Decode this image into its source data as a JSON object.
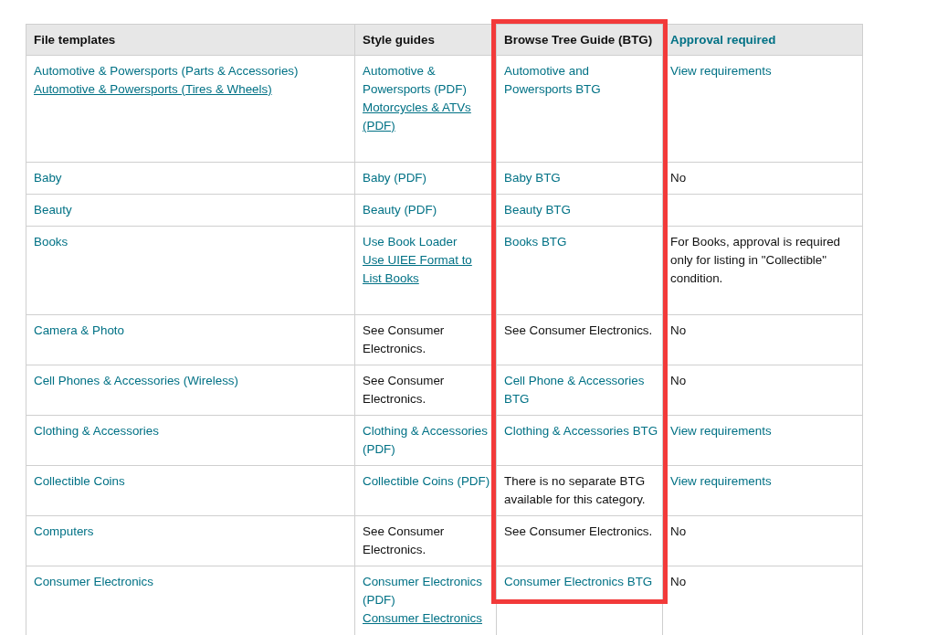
{
  "table": {
    "columns": [
      {
        "label": "File templates",
        "kind": "text"
      },
      {
        "label": "Style guides",
        "kind": "text"
      },
      {
        "label": "Browse Tree Guide (BTG)",
        "kind": "text",
        "highlighted": true
      },
      {
        "label": "Approval required",
        "kind": "link"
      }
    ],
    "rows": [
      {
        "cells": [
          [
            {
              "text": "Automotive & Powersports (Parts & Accessories)",
              "kind": "link",
              "underlined": false
            },
            {
              "text": "Automotive & Powersports (Tires & Wheels)",
              "kind": "link",
              "underlined": true
            }
          ],
          [
            {
              "text": "Automotive & Powersports (PDF)",
              "kind": "link",
              "underlined": false
            },
            {
              "text": "Motorcycles & ATVs (PDF)",
              "kind": "link",
              "underlined": true
            }
          ],
          [
            {
              "text": "Automotive and Powersports BTG",
              "kind": "link",
              "underlined": false
            }
          ],
          [
            {
              "text": "View requirements",
              "kind": "link",
              "underlined": false
            }
          ]
        ]
      },
      {
        "cells": [
          [
            {
              "text": "Baby",
              "kind": "link",
              "underlined": false
            }
          ],
          [
            {
              "text": "Baby (PDF)",
              "kind": "link",
              "underlined": false
            }
          ],
          [
            {
              "text": "Baby BTG",
              "kind": "link",
              "underlined": false
            }
          ],
          [
            {
              "text": "No",
              "kind": "text"
            }
          ]
        ]
      },
      {
        "cells": [
          [
            {
              "text": "Beauty",
              "kind": "link",
              "underlined": false
            }
          ],
          [
            {
              "text": "Beauty (PDF)",
              "kind": "link",
              "underlined": false
            }
          ],
          [
            {
              "text": "Beauty BTG",
              "kind": "link",
              "underlined": false
            }
          ],
          []
        ]
      },
      {
        "cells": [
          [
            {
              "text": "Books",
              "kind": "link",
              "underlined": false
            }
          ],
          [
            {
              "text": "Use Book Loader",
              "kind": "link",
              "underlined": false
            },
            {
              "text": "Use UIEE Format to List Books",
              "kind": "link",
              "underlined": true
            }
          ],
          [
            {
              "text": "Books BTG",
              "kind": "link",
              "underlined": false
            }
          ],
          [
            {
              "text": "For Books, approval is required only for listing in \"Collectible\" condition.",
              "kind": "text"
            }
          ]
        ]
      },
      {
        "cells": [
          [
            {
              "text": "Camera & Photo",
              "kind": "link",
              "underlined": false
            }
          ],
          [
            {
              "text": "See Consumer Electronics.",
              "kind": "text"
            }
          ],
          [
            {
              "text": "See Consumer Electronics.",
              "kind": "text"
            }
          ],
          [
            {
              "text": "No",
              "kind": "text"
            }
          ]
        ]
      },
      {
        "cells": [
          [
            {
              "text": "Cell Phones & Accessories (Wireless)",
              "kind": "link",
              "underlined": false
            }
          ],
          [
            {
              "text": "See Consumer Electronics.",
              "kind": "text"
            }
          ],
          [
            {
              "text": "Cell Phone & Accessories BTG",
              "kind": "link",
              "underlined": false
            }
          ],
          [
            {
              "text": "No",
              "kind": "text"
            }
          ]
        ]
      },
      {
        "cells": [
          [
            {
              "text": "Clothing & Accessories",
              "kind": "link",
              "underlined": false
            }
          ],
          [
            {
              "text": "Clothing & Accessories (PDF)",
              "kind": "link",
              "underlined": false
            }
          ],
          [
            {
              "text": "Clothing & Accessories BTG",
              "kind": "link",
              "underlined": false
            }
          ],
          [
            {
              "text": "View requirements",
              "kind": "link",
              "underlined": false
            }
          ]
        ]
      },
      {
        "cells": [
          [
            {
              "text": "Collectible Coins",
              "kind": "link",
              "underlined": false
            }
          ],
          [
            {
              "text": "Collectible Coins (PDF)",
              "kind": "link",
              "underlined": false
            }
          ],
          [
            {
              "text": "There is no separate BTG available for this category.",
              "kind": "text"
            }
          ],
          [
            {
              "text": "View requirements",
              "kind": "link",
              "underlined": false
            }
          ]
        ]
      },
      {
        "cells": [
          [
            {
              "text": "Computers",
              "kind": "link",
              "underlined": false
            }
          ],
          [
            {
              "text": "See Consumer Electronics.",
              "kind": "text"
            }
          ],
          [
            {
              "text": "See Consumer Electronics.",
              "kind": "text"
            }
          ],
          [
            {
              "text": "No",
              "kind": "text"
            }
          ]
        ]
      },
      {
        "cells": [
          [
            {
              "text": "Consumer Electronics",
              "kind": "link",
              "underlined": false
            }
          ],
          [
            {
              "text": "Consumer Electronics (PDF)",
              "kind": "link",
              "underlined": false
            },
            {
              "text": "Consumer Electronics",
              "kind": "link",
              "underlined": true
            }
          ],
          [
            {
              "text": "Consumer Electronics BTG",
              "kind": "link",
              "underlined": false
            }
          ],
          [
            {
              "text": "No",
              "kind": "text"
            }
          ]
        ]
      }
    ]
  }
}
